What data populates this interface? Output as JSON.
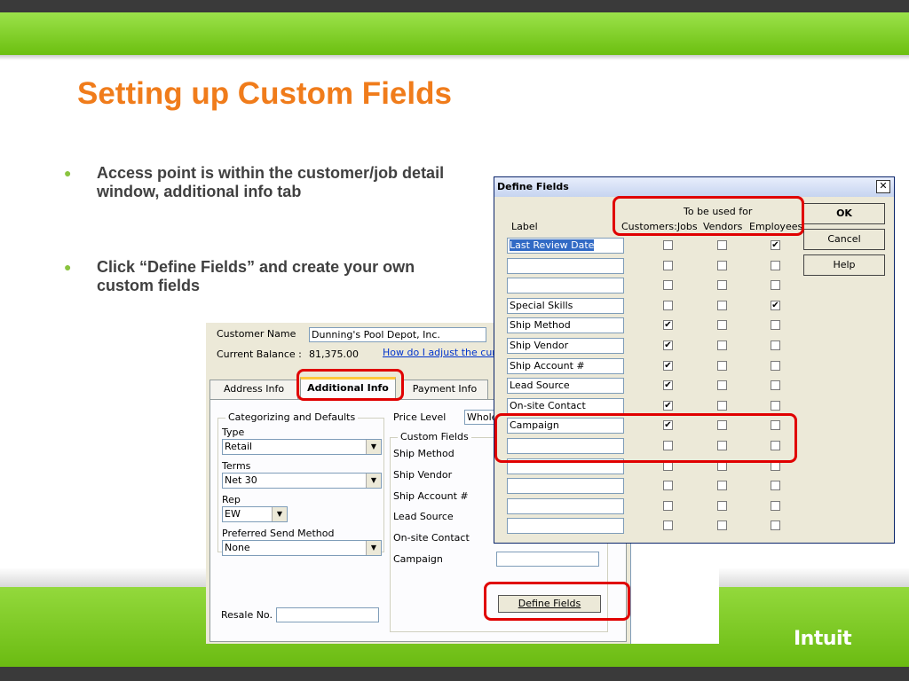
{
  "slide": {
    "title": "Setting up Custom Fields",
    "bullets": [
      "Access point is within the customer/job detail window, additional info tab",
      "Click “Define Fields” and create your own custom fields"
    ],
    "logo": "Intuit",
    "accent_color": "#f07c1b",
    "green_color": "#7fcd28"
  },
  "customer_window": {
    "customer_name_label": "Customer Name",
    "customer_name_value": "Dunning's Pool Depot, Inc.",
    "balance_label": "Current Balance :",
    "balance_value": "81,375.00",
    "balance_link": "How do I adjust the curr",
    "tabs": [
      "Address Info",
      "Additional Info",
      "Payment Info"
    ],
    "active_tab": "Additional Info",
    "categorizing_group": "Categorizing and Defaults",
    "type_label": "Type",
    "type_value": "Retail",
    "terms_label": "Terms",
    "terms_value": "Net 30",
    "rep_label": "Rep",
    "rep_value": "EW",
    "send_method_label": "Preferred Send Method",
    "send_method_value": "None",
    "price_level_label": "Price Level",
    "price_level_value": "Whole",
    "custom_fields_group": "Custom Fields",
    "custom_fields": [
      "Ship Method",
      "Ship Vendor",
      "Ship Account #",
      "Lead Source",
      "On-site Contact",
      "Campaign"
    ],
    "define_fields_button": "Define Fields",
    "resale_label": "Resale No."
  },
  "define_fields_dialog": {
    "title": "Define Fields",
    "close_glyph": "✕",
    "used_for_header": "To be used for",
    "label_header": "Label",
    "column_headers": [
      "Customers:Jobs",
      "Vendors",
      "Employees"
    ],
    "rows": [
      {
        "label": "Last Review Date",
        "cust": false,
        "vend": false,
        "emp": true
      },
      {
        "label": "",
        "cust": false,
        "vend": false,
        "emp": false
      },
      {
        "label": "",
        "cust": false,
        "vend": false,
        "emp": false
      },
      {
        "label": "Special Skills",
        "cust": false,
        "vend": false,
        "emp": true
      },
      {
        "label": "Ship Method",
        "cust": true,
        "vend": false,
        "emp": false
      },
      {
        "label": "Ship Vendor",
        "cust": true,
        "vend": false,
        "emp": false
      },
      {
        "label": "Ship Account #",
        "cust": true,
        "vend": false,
        "emp": false
      },
      {
        "label": "Lead Source",
        "cust": true,
        "vend": false,
        "emp": false
      },
      {
        "label": "On-site Contact",
        "cust": true,
        "vend": false,
        "emp": false
      },
      {
        "label": "Campaign",
        "cust": true,
        "vend": false,
        "emp": false
      },
      {
        "label": "",
        "cust": false,
        "vend": false,
        "emp": false
      },
      {
        "label": "",
        "cust": false,
        "vend": false,
        "emp": false
      },
      {
        "label": "",
        "cust": false,
        "vend": false,
        "emp": false
      },
      {
        "label": "",
        "cust": false,
        "vend": false,
        "emp": false
      },
      {
        "label": "",
        "cust": false,
        "vend": false,
        "emp": false
      }
    ],
    "buttons": [
      "OK",
      "Cancel",
      "Help"
    ]
  }
}
